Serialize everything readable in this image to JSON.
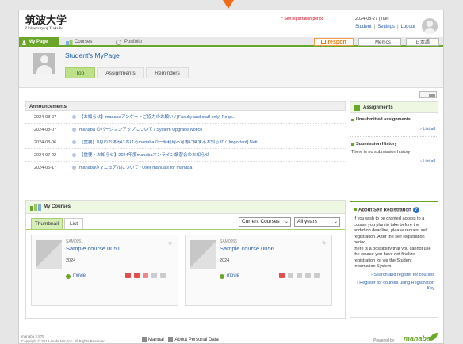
{
  "header": {
    "logo_title": "筑波大学",
    "logo_sub": "University of Tsukuba",
    "registration_period": "* Self registration period",
    "date": "2024-08-27 (Tue)",
    "links": [
      "Student",
      "Settings",
      "Logout"
    ]
  },
  "nav": {
    "tabs": [
      "My Page",
      "Courses",
      "Portfolio"
    ],
    "respon": "respon",
    "memos": "Memos",
    "language": "日本語"
  },
  "mypage": {
    "title": "Student's MyPage",
    "tabs": [
      "Top",
      "Assignments",
      "Reminders"
    ]
  },
  "announcements": {
    "heading": "Announcements",
    "items": [
      {
        "date": "2024-08-07",
        "text": "【お知らせ】manabaアンケートご協力のお願い / [Faculty and staff only] Requ..."
      },
      {
        "date": "2024-08-07",
        "text": "manaba のバージョンアップについて / System Upgrade Notice"
      },
      {
        "date": "2024-08-06",
        "text": "【重要】8月のお休みにおけるmanabaの一時利用不可等に関するお知らせ / [Important] Noti..."
      },
      {
        "date": "2024-07-22",
        "text": "【重要・お知らせ】2024年度manabaオンライン講習会のお知らせ"
      },
      {
        "date": "2024-05-17",
        "text": "manabaのマニュアルについて / User manuals for manaba"
      }
    ]
  },
  "courses": {
    "heading": "My Courses",
    "tabs": [
      "Thumbnail",
      "List"
    ],
    "filter": "Current Courses",
    "years": "All years",
    "items": [
      {
        "code": "SAM0051",
        "name": "Sample course 0051",
        "year": "2024",
        "movie": "movie"
      },
      {
        "code": "SAM0056",
        "name": "Sample course 0056",
        "year": "2024",
        "movie": "movie"
      }
    ]
  },
  "assignments": {
    "heading": "Assignments",
    "unsubmitted": "Unsubmitted assignments",
    "list_all": "List all",
    "history": "Submission History",
    "history_text": "There is no submission history",
    "list_all_2": "List all"
  },
  "self_registration": {
    "title": "About Self Registration",
    "text1": "If you wish to be granted access to a course you plan to take before the add/drop deadline, please request self registration. After the self registration period,",
    "text2": "there is a possibility that you cannot use the course you have not finalize registration for via the Student Information System.",
    "link1": "Search and register for courses",
    "link2": "Register for courses using Registration Key"
  },
  "footer": {
    "version": "manaba 2.975",
    "copyright": "Copyright © 2013 Asahi Net, Inc. All Rights Reserved.",
    "manual": "Manual",
    "personal": "About Personal Data",
    "powered": "Powered by",
    "brand": "manaba"
  },
  "colors": {
    "accent": "#6aa62a",
    "link": "#2a5da8",
    "alert": "#d0021b",
    "respon": "#e8770c"
  }
}
